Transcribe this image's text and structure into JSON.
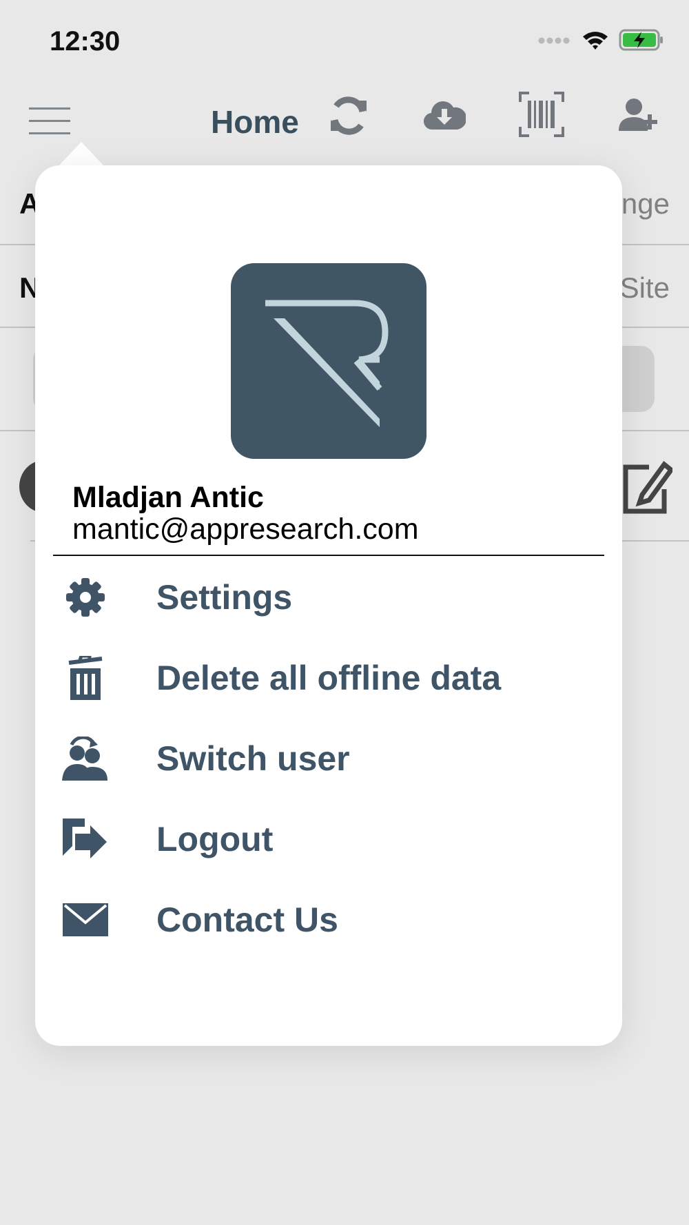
{
  "status_bar": {
    "time": "12:30",
    "icons": [
      "signal-icon",
      "wifi-icon",
      "battery-charging-icon"
    ]
  },
  "nav_bar": {
    "title": "Home",
    "icons": [
      "menu-icon",
      "sync-icon",
      "cloud-download-icon",
      "barcode-icon",
      "add-user-icon"
    ]
  },
  "background": {
    "row1_lead": "A",
    "row1_trail": "nge",
    "row2_lead": "N",
    "row2_trail": "Site"
  },
  "menu": {
    "user_name": "Mladjan Antic",
    "user_email": "mantic@appresearch.com",
    "items": [
      {
        "label": "Settings",
        "icon": "gear-icon"
      },
      {
        "label": "Delete all offline data",
        "icon": "trash-icon"
      },
      {
        "label": "Switch user",
        "icon": "switch-user-icon"
      },
      {
        "label": "Logout",
        "icon": "logout-icon"
      },
      {
        "label": "Contact Us",
        "icon": "envelope-icon"
      }
    ]
  },
  "colors": {
    "accent": "#3f5567",
    "logo_bg": "#405664",
    "logo_mark": "#c2d4dc"
  }
}
